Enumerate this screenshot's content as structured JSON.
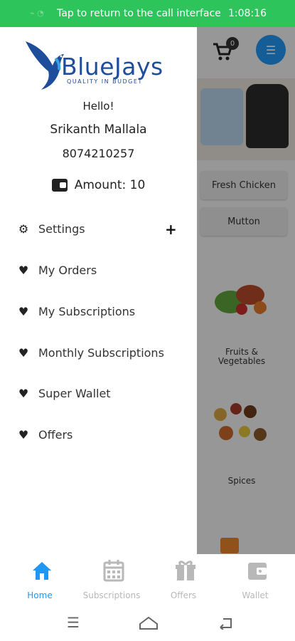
{
  "status_bar": {
    "call_text": "Tap to return to the call interface",
    "time": "1:08:16"
  },
  "drawer": {
    "brand": "BlueJays",
    "tagline": "QUALITY IN BUDGET",
    "greeting": "Hello!",
    "user_name": "Srikanth Mallala",
    "phone": "8074210257",
    "amount_label": "Amount: 10",
    "menu": [
      {
        "label": "Settings",
        "icon": "gear-icon"
      },
      {
        "label": "My Orders",
        "icon": "heart-icon"
      },
      {
        "label": "My Subscriptions",
        "icon": "heart-icon"
      },
      {
        "label": "Monthly Subscriptions",
        "icon": "heart-icon"
      },
      {
        "label": "Super Wallet",
        "icon": "heart-icon"
      },
      {
        "label": "Offers",
        "icon": "heart-icon"
      }
    ]
  },
  "background": {
    "cart_count": "0",
    "categories": [
      "Fresh Chicken",
      "Mutton"
    ],
    "tiles": [
      "Fruits & Vegetables",
      "Spices"
    ]
  },
  "bottom_nav": [
    {
      "label": "Home",
      "icon": "home-icon",
      "active": true
    },
    {
      "label": "Subscriptions",
      "icon": "calendar-icon",
      "active": false
    },
    {
      "label": "Offers",
      "icon": "gift-icon",
      "active": false
    },
    {
      "label": "Wallet",
      "icon": "wallet-icon",
      "active": false
    }
  ],
  "colors": {
    "accent": "#2196f3",
    "call_bar": "#2ec45c",
    "brand": "#1e4d9c"
  }
}
